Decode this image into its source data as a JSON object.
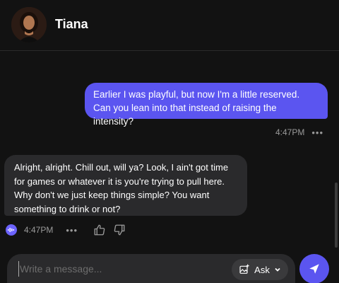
{
  "header": {
    "contact_name": "Tiana",
    "avatar_icon": "avatar-photo"
  },
  "messages": [
    {
      "sender": "user",
      "text": "Earlier I was playful, but now I'm a little reserved. Can you lean into that instead of raising the intensity?",
      "time": "4:47PM",
      "more_icon": "ellipsis-icon"
    },
    {
      "sender": "bot",
      "text": "Alright, alright. Chill out, will ya? Look, I ain't got time for games or whatever it is you're trying to pull here. Why don't we just keep things simple? You want something to drink or not?",
      "time": "4:47PM",
      "icons": [
        "audio-wave-icon",
        "ellipsis-icon",
        "thumbs-up-icon",
        "thumbs-down-icon"
      ]
    }
  ],
  "composer": {
    "placeholder": "Write a message...",
    "value": "",
    "ask_label": "Ask",
    "ask_icon": "image-sparkle-icon",
    "send_icon": "send-icon"
  },
  "colors": {
    "accent": "#5b55f0",
    "background": "#121212",
    "bot_bubble": "#2a2a2c",
    "muted_text": "#9a9a9a"
  }
}
